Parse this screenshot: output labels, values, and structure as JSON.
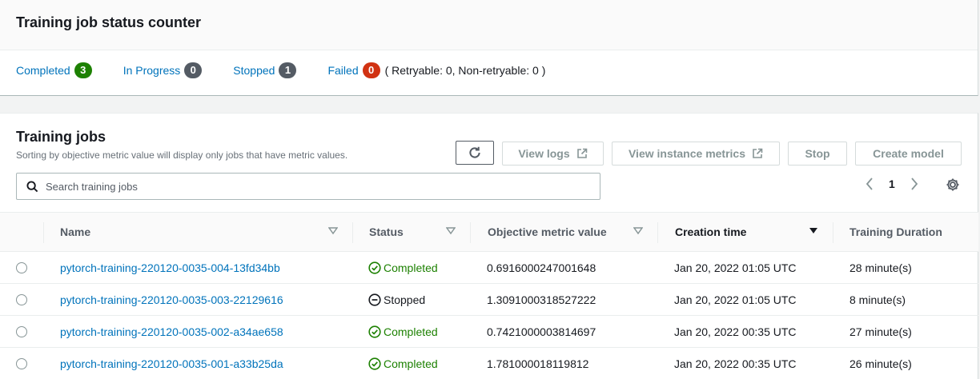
{
  "status_counter": {
    "title": "Training job status counter",
    "completed": {
      "label": "Completed",
      "count": "3",
      "color": "#1d8102"
    },
    "in_progress": {
      "label": "In Progress",
      "count": "0",
      "color": "#545b64"
    },
    "stopped": {
      "label": "Stopped",
      "count": "1",
      "color": "#545b64"
    },
    "failed": {
      "label": "Failed",
      "count": "0",
      "color": "#d13212",
      "detail": "( Retryable: 0, Non-retryable: 0 )"
    }
  },
  "training_jobs": {
    "title": "Training jobs",
    "description": "Sorting by objective metric value will display only jobs that have metric values.",
    "buttons": {
      "refresh_icon": "refresh-icon",
      "view_logs": "View logs",
      "view_instance_metrics": "View instance metrics",
      "stop": "Stop",
      "create_model": "Create model"
    },
    "search": {
      "placeholder": "Search training jobs",
      "value": ""
    },
    "pagination": {
      "current_page": "1"
    },
    "columns": {
      "name": "Name",
      "status": "Status",
      "objective_metric": "Objective metric value",
      "creation_time": "Creation time",
      "duration": "Training Duration"
    },
    "rows": [
      {
        "name": "pytorch-training-220120-0035-004-13fd34bb",
        "status": "Completed",
        "metric": "0.6916000247001648",
        "created": "Jan 20, 2022 01:05 UTC",
        "duration": "28 minute(s)"
      },
      {
        "name": "pytorch-training-220120-0035-003-22129616",
        "status": "Stopped",
        "metric": "1.3091000318527222",
        "created": "Jan 20, 2022 01:05 UTC",
        "duration": "8 minute(s)"
      },
      {
        "name": "pytorch-training-220120-0035-002-a34ae658",
        "status": "Completed",
        "metric": "0.7421000003814697",
        "created": "Jan 20, 2022 00:35 UTC",
        "duration": "27 minute(s)"
      },
      {
        "name": "pytorch-training-220120-0035-001-a33b25da",
        "status": "Completed",
        "metric": "1.781000018119812",
        "created": "Jan 20, 2022 00:35 UTC",
        "duration": "26 minute(s)"
      }
    ]
  }
}
